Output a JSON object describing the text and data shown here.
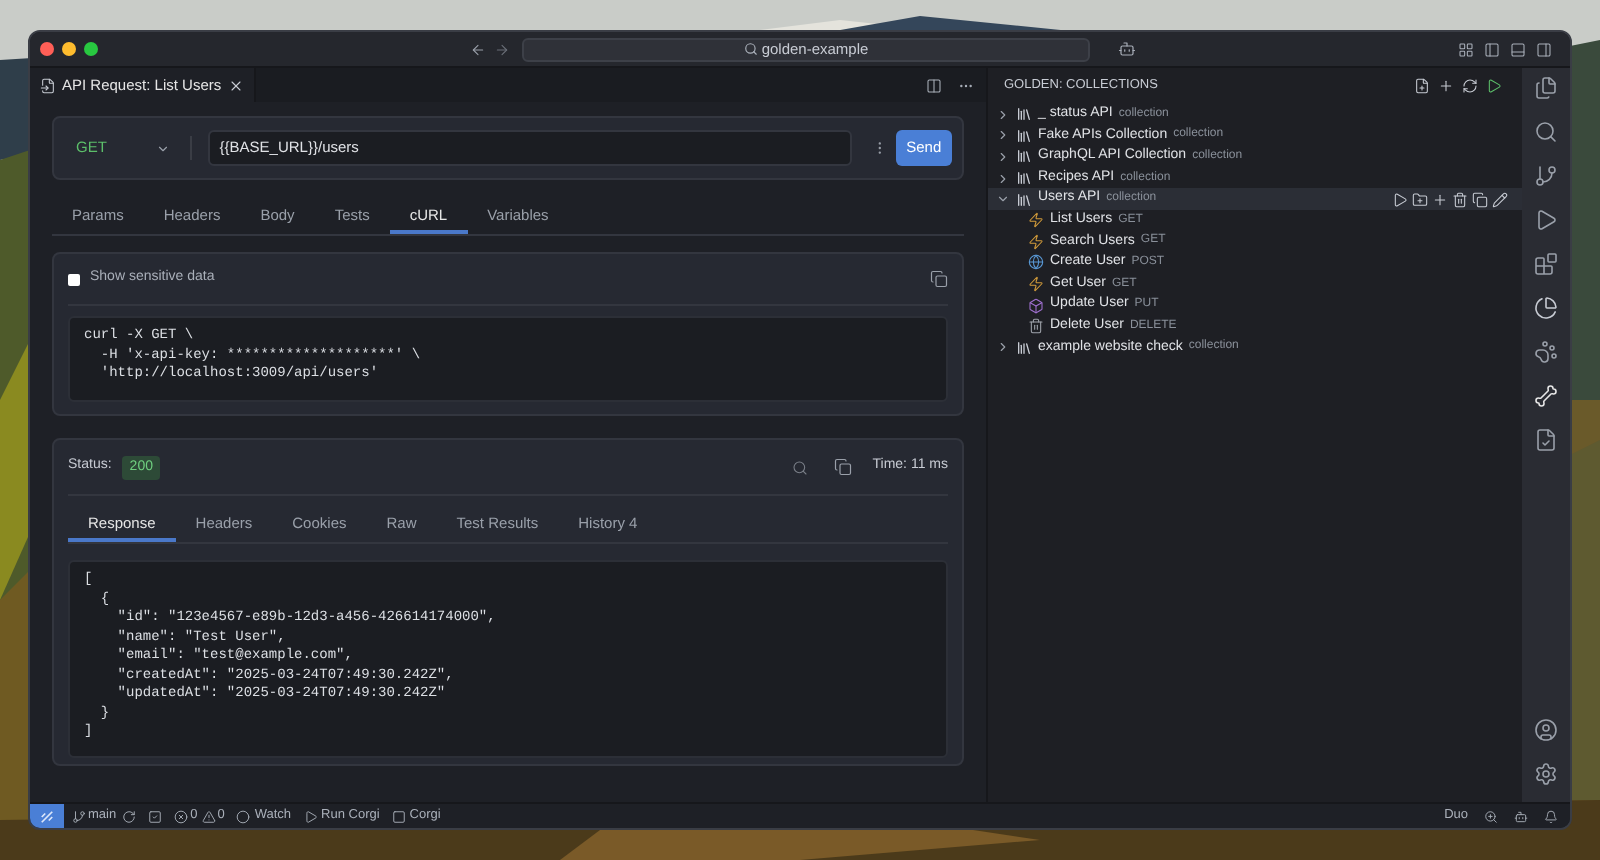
{
  "window": {
    "search": "golden-example"
  },
  "editor_tab": {
    "title": "API Request: List Users"
  },
  "request": {
    "method": "GET",
    "url": "{{BASE_URL}}/users",
    "send": "Send"
  },
  "request_tabs": [
    {
      "label": "Params",
      "selected": false
    },
    {
      "label": "Headers",
      "selected": false
    },
    {
      "label": "Body",
      "selected": false
    },
    {
      "label": "Tests",
      "selected": false
    },
    {
      "label": "cURL",
      "selected": true
    },
    {
      "label": "Variables",
      "selected": false
    }
  ],
  "curl": {
    "sensitive_label": "Show sensitive data",
    "checked": false,
    "lines": [
      "curl -X GET \\",
      "  -H 'x-api-key: ********************' \\",
      "  'http://localhost:3009/api/users'"
    ]
  },
  "response": {
    "status_label": "Status:",
    "status": "200",
    "time": "Time: 11 ms",
    "tabs": [
      {
        "label": "Response",
        "selected": true
      },
      {
        "label": "Headers",
        "selected": false
      },
      {
        "label": "Cookies",
        "selected": false
      },
      {
        "label": "Raw",
        "selected": false
      },
      {
        "label": "Test Results",
        "selected": false
      },
      {
        "label": "History 4",
        "selected": false
      }
    ],
    "body_lines": [
      "[",
      "  {",
      "    \"id\": \"123e4567-e89b-12d3-a456-426614174000\",",
      "    \"name\": \"Test User\",",
      "    \"email\": \"test@example.com\",",
      "    \"createdAt\": \"2025-03-24T07:49:30.242Z\",",
      "    \"updatedAt\": \"2025-03-24T07:49:30.242Z\"",
      "  }",
      "]"
    ]
  },
  "sidebar": {
    "title": "GOLDEN: COLLECTIONS",
    "collections": [
      {
        "name": "_ status API",
        "tag": "collection",
        "expanded": false,
        "selected": false
      },
      {
        "name": "Fake APIs Collection",
        "tag": "collection",
        "expanded": false,
        "selected": false
      },
      {
        "name": "GraphQL API Collection",
        "tag": "collection",
        "expanded": false,
        "selected": false
      },
      {
        "name": "Recipes API",
        "tag": "collection",
        "expanded": false,
        "selected": false
      },
      {
        "name": "Users API",
        "tag": "collection",
        "expanded": true,
        "selected": true,
        "children": [
          {
            "name": "List Users",
            "method": "GET",
            "kind": "get"
          },
          {
            "name": "Search Users",
            "method": "GET",
            "kind": "get"
          },
          {
            "name": "Create User",
            "method": "POST",
            "kind": "post"
          },
          {
            "name": "Get User",
            "method": "GET",
            "kind": "get"
          },
          {
            "name": "Update User",
            "method": "PUT",
            "kind": "put"
          },
          {
            "name": "Delete User",
            "method": "DELETE",
            "kind": "delete"
          }
        ]
      },
      {
        "name": "example website check",
        "tag": "collection",
        "expanded": false,
        "selected": false
      }
    ]
  },
  "status_bar": {
    "branch": "main",
    "errors": "0",
    "warnings": "0",
    "watch": "Watch",
    "run": "Run Corgi",
    "corgi": "Corgi",
    "duo": "Duo"
  }
}
